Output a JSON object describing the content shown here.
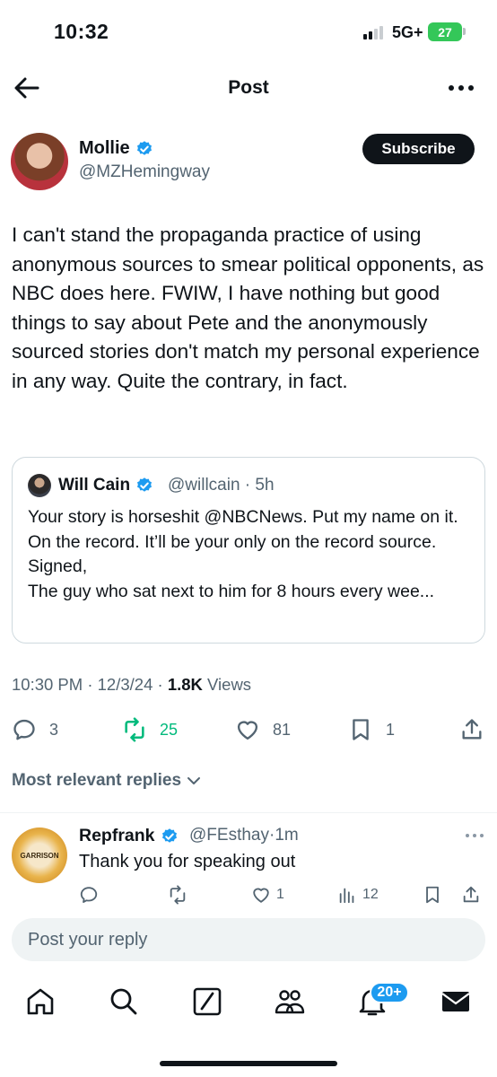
{
  "status_bar": {
    "time": "10:32",
    "network": "5G+",
    "battery": "27"
  },
  "header": {
    "title": "Post"
  },
  "post": {
    "author_name": "Mollie",
    "author_handle": "@MZHemingway",
    "subscribe_label": "Subscribe",
    "text": "I can't stand the propaganda practice of using anonymous sources to smear political opponents, as NBC does here. FWIW, I have nothing but good things to say about Pete and the anonymously sourced stories don't match my personal experience in any way. Quite the contrary, in fact.",
    "quote": {
      "author_name": "Will Cain",
      "author_handle": "@willcain",
      "age": "5h",
      "text": "Your story is horseshit @NBCNews. Put my name on it. On the record. It’ll be your only on the record source.\nSigned,\nThe guy who sat next to him for 8 hours every wee..."
    },
    "time": "10:30 PM",
    "date": "12/3/24",
    "views_count": "1.8K",
    "views_label": "Views",
    "actions": {
      "replies": "3",
      "reposts": "25",
      "likes": "81",
      "bookmarks": "1"
    }
  },
  "replies_filter": "Most relevant replies",
  "reply": {
    "author_name": "Repfrank",
    "author_handle": "@FEsthay",
    "age": "1m",
    "text": "Thank you for speaking out",
    "avatar_text": "GARRISON",
    "actions": {
      "replies": "",
      "reposts": "",
      "likes": "1",
      "views": "12"
    }
  },
  "composer": {
    "placeholder": "Post your reply"
  },
  "tabbar": {
    "notifications_badge": "20+"
  },
  "colors": {
    "accent": "#1d9bf0",
    "repost_active": "#00ba7c",
    "text": "#0f1419",
    "secondary": "#536471"
  },
  "icons": [
    "back-arrow-icon",
    "more-icon",
    "verified-icon",
    "reply-icon",
    "repost-icon",
    "like-icon",
    "bookmark-icon",
    "share-icon",
    "views-icon",
    "home-icon",
    "search-icon",
    "grok-icon",
    "communities-icon",
    "bell-icon",
    "mail-icon"
  ]
}
